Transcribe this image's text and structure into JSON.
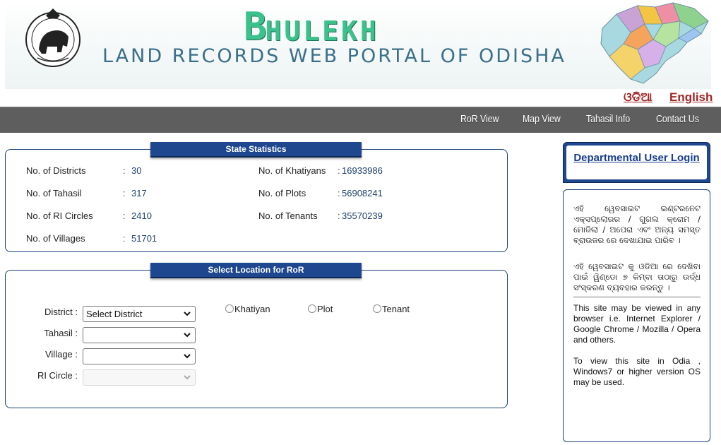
{
  "header": {
    "brand_first": "B",
    "brand_rest": "HULEKH",
    "subtitle": "LAND RECORDS WEB PORTAL OF ODISHA",
    "emblem_icon": "odisha-state-emblem-icon",
    "map_icon": "odisha-district-map-icon"
  },
  "language": {
    "odia": "ଓଡିଆ",
    "english": "English"
  },
  "nav": {
    "items": [
      "RoR View",
      "Map View",
      "Tahasil Info",
      "Contact Us"
    ]
  },
  "stats": {
    "title": "State Statistics",
    "rows": [
      {
        "label": "No. of Districts",
        "value": "30"
      },
      {
        "label": "No. of Tahasil",
        "value": "317"
      },
      {
        "label": "No. of RI Circles",
        "value": "2410"
      },
      {
        "label": "No. of Villages",
        "value": "51701"
      },
      {
        "label": "No. of Khatiyans",
        "value": "16933986"
      },
      {
        "label": "No. of Plots",
        "value": "56908241"
      },
      {
        "label": "No. of Tenants",
        "value": "35570239"
      }
    ],
    "colon": ":"
  },
  "location": {
    "title": "Select Location for RoR",
    "district_label": "District :",
    "tahasil_label": "Tahasil :",
    "village_label": "Village :",
    "ri_circle_label": "RI Circle :",
    "district_value": "Select District",
    "tahasil_value": "",
    "village_value": "",
    "ri_circle_value": "",
    "radios": [
      "Khatiyan",
      "Plot",
      "Tenant"
    ]
  },
  "sidebar": {
    "login_label": "Departmental User Login",
    "odia_para1": "ଏହି ୱେବସାଇଟ ଇଣ୍ଟରନେଟ ଏକ୍ସପ୍ଲୋରର / ଗୁଗଲ କ୍ରୋମ / ମୋଜିଲା / ଅପେରା ଏବଂ ଅନ୍ୟ ସମସ୍ତ ବ୍ରାଉଜର ରେ ଦେଖାଯାଇ ପାରିବ ।",
    "odia_para2": "ଏହି ୱେବସାଇଟ କୁ ଓଡିଆ ରେ ଦେଖିବା ପାଇଁ ୱିଣ୍ଡୋ ୭ କିମ୍ବା ତାଠାରୁ ଉର୍ଦ୍ଧ ସଂସ୍କରଣ ବ୍ୟବହାର କରନ୍ତୁ ।",
    "en_para1": "This site may be viewed in any browser i.e. Internet Explorer / Google Chrome / Mozilla / Opera and others.",
    "en_para2": "To view this site in Odia , Windows7 or higher version OS may be used."
  },
  "colors": {
    "nav_bg": "#5e5e5e",
    "box_border": "#1c3f7a",
    "title_bg": "#1e4790",
    "brand_green": "#3bc28c",
    "lang_red": "#a32626"
  }
}
